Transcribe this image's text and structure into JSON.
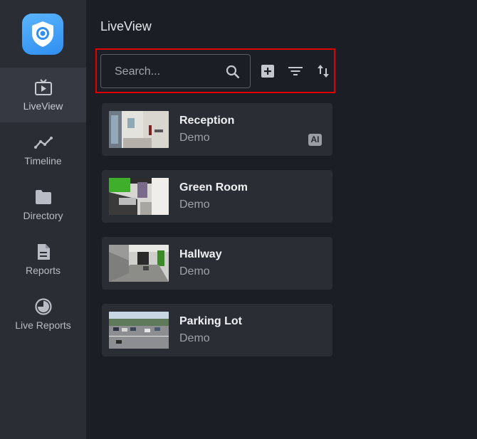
{
  "sidebar": {
    "items": [
      {
        "label": "LiveView",
        "icon": "tv-play-icon",
        "active": true
      },
      {
        "label": "Timeline",
        "icon": "timeline-icon",
        "active": false
      },
      {
        "label": "Directory",
        "icon": "folder-icon",
        "active": false
      },
      {
        "label": "Reports",
        "icon": "document-icon",
        "active": false
      },
      {
        "label": "Live Reports",
        "icon": "clock-pie-icon",
        "active": false
      }
    ]
  },
  "header": {
    "title": "LiveView"
  },
  "search": {
    "placeholder": "Search...",
    "value": ""
  },
  "toolbar": {
    "add_icon": "add-box-icon",
    "filter_icon": "filter-icon",
    "sort_icon": "sort-icon"
  },
  "cameras": [
    {
      "name": "Reception",
      "location": "Demo",
      "badge": "AI"
    },
    {
      "name": "Green Room",
      "location": "Demo",
      "badge": ""
    },
    {
      "name": "Hallway",
      "location": "Demo",
      "badge": ""
    },
    {
      "name": "Parking Lot",
      "location": "Demo",
      "badge": ""
    }
  ],
  "colors": {
    "background": "#1c1e26",
    "sidebar": "#2b2d35",
    "card": "#2b2d35",
    "accent": "#2f8ff0",
    "highlight_outline": "#e00000"
  }
}
